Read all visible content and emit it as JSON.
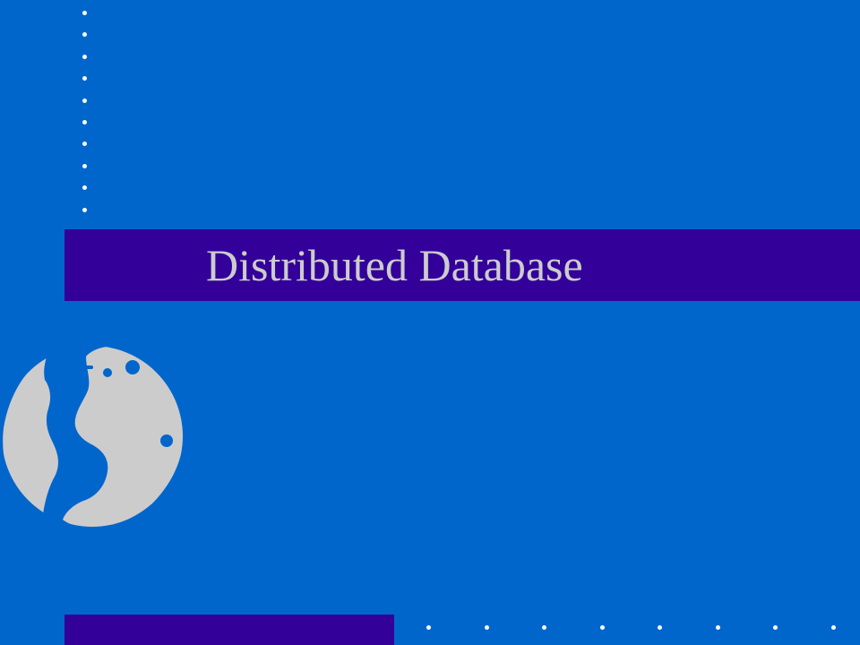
{
  "slide": {
    "title": "Distributed Database"
  },
  "colors": {
    "background": "#0066cc",
    "title_band": "#330099",
    "title_text": "#cccccc",
    "globe": "#cccccc",
    "dots": "#ffffff"
  },
  "icons": {
    "globe": "globe-icon"
  }
}
